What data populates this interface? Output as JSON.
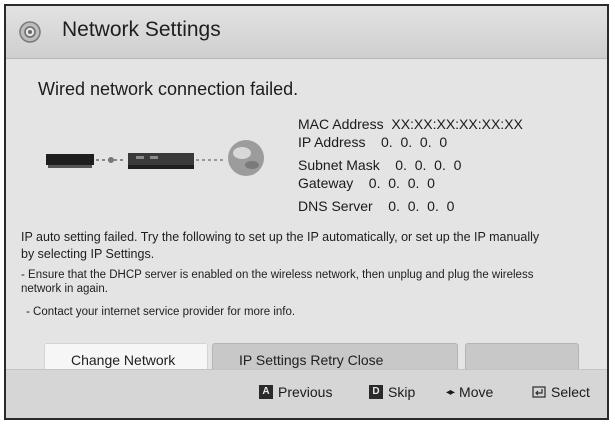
{
  "header": {
    "title": "Network Settings",
    "icon": "gear-icon"
  },
  "status": {
    "headline": "Wired network connection failed."
  },
  "network_info": {
    "mac_address": "MAC Address  XX:XX:XX:XX:XX:XX",
    "ip_address": "IP Address    0.  0.  0.  0",
    "subnet_mask": "Subnet Mask    0.  0.  0.  0",
    "gateway": "Gateway    0.  0.  0.  0",
    "dns_server": "DNS Server    0.  0.  0.  0"
  },
  "messages": {
    "main_line1": "IP auto setting failed. Try the following to set up the IP automatically, or set up the IP manually",
    "main_line2": "by selecting IP Settings.",
    "tip1_line1": "- Ensure that the DHCP server is enabled on the wireless network, then unplug and plug the wireless",
    "tip1_line2": "network in again.",
    "tip2": "- Contact your internet service provider for more info."
  },
  "buttons": {
    "change_network": "Change Network",
    "ip_settings_retry_close": "IP Settings  Retry  Close",
    "empty": ""
  },
  "footer": {
    "previous_key": "A",
    "previous": "Previous",
    "skip_key": "D",
    "skip": "Skip",
    "move_arrows": "◂▸",
    "move": "Move",
    "select": "Select"
  },
  "colors": {
    "focused_button": "#f6f6f6",
    "button": "#c8c8c8",
    "background": "#e4e4e4"
  }
}
